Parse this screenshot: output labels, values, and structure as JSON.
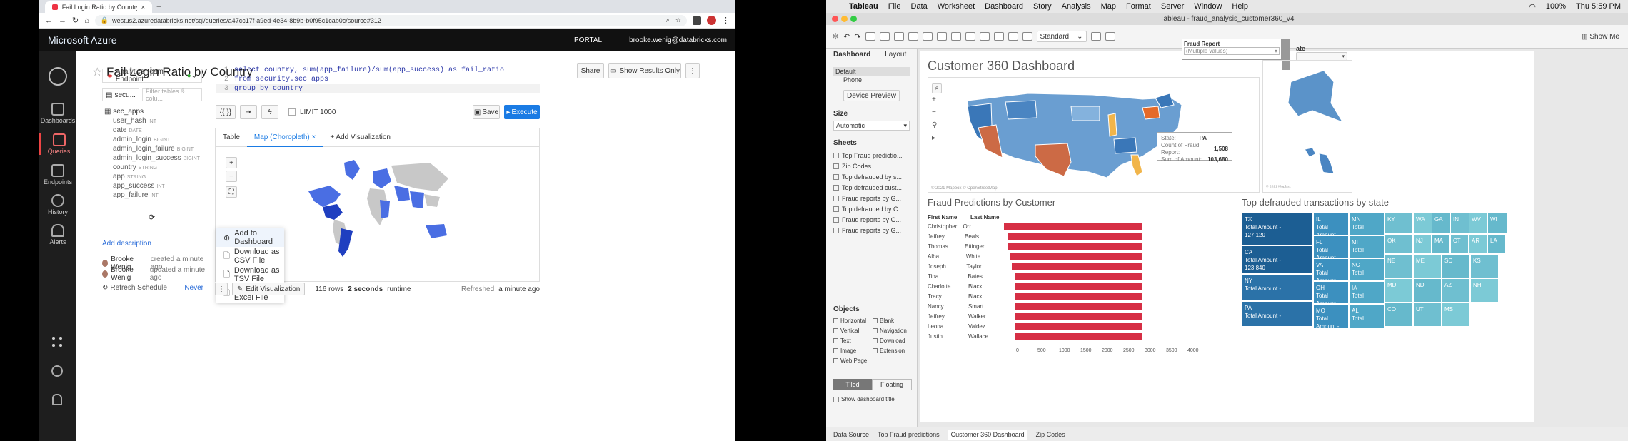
{
  "browser": {
    "tab_title": "Fail Login Ratio by Country",
    "url": "westus2.azuredatabricks.net/sql/queries/a47cc17f-a9ed-4e34-8b9b-b0f95c1cab0c/source#312"
  },
  "azure": {
    "brand": "Microsoft Azure",
    "portal": "PORTAL",
    "user": "brooke.wenig@databricks.com"
  },
  "rail": [
    {
      "label": "Dashboards"
    },
    {
      "label": "Queries"
    },
    {
      "label": "Endpoints"
    },
    {
      "label": "History"
    },
    {
      "label": "Alerts"
    }
  ],
  "query": {
    "title": "Fail Login Ratio by Country",
    "share": "Share",
    "show_results": "Show Results Only",
    "endpoint": "Analytics Team Endpoint",
    "schema_sel": "secu...",
    "filter_placeholder": "Filter tables & colu...",
    "add_description": "Add description"
  },
  "schema": {
    "table": "sec_apps",
    "columns": [
      {
        "name": "user_hash",
        "type": "INT"
      },
      {
        "name": "date",
        "type": "DATE"
      },
      {
        "name": "admin_login",
        "type": "BIGINT"
      },
      {
        "name": "admin_login_failure",
        "type": "BIGINT"
      },
      {
        "name": "admin_login_success",
        "type": "BIGINT"
      },
      {
        "name": "country",
        "type": "STRING"
      },
      {
        "name": "app",
        "type": "STRING"
      },
      {
        "name": "app_success",
        "type": "INT"
      },
      {
        "name": "app_failure",
        "type": "INT"
      }
    ]
  },
  "editor": {
    "lines": [
      {
        "n": "1",
        "code": "select country, sum(app_failure)/sum(app_success) as fail_ratio"
      },
      {
        "n": "2",
        "code": "from security.sec_apps"
      },
      {
        "n": "3",
        "code": "group by country"
      }
    ],
    "limit": "LIMIT 1000",
    "save": "Save",
    "execute": "Execute"
  },
  "results": {
    "tabs": [
      "Table",
      "Map (Choropleth)"
    ],
    "add_vis": "+ Add Visualization",
    "menu": [
      "Add to Dashboard",
      "Download as CSV File",
      "Download as TSV File",
      "Download as Excel File"
    ],
    "edit_vis": "Edit Visualization",
    "rows": "116 rows",
    "runtime": "2 seconds",
    "runtime_suffix": "runtime",
    "refreshed": "Refreshed",
    "refreshed_when": "a minute ago"
  },
  "activity": [
    {
      "user": "Brooke Wenig",
      "action": "created a minute ago"
    },
    {
      "user": "Brooke Wenig",
      "action": "updated a minute ago"
    }
  ],
  "refresh": {
    "label": "Refresh Schedule",
    "value": "Never"
  },
  "mac": {
    "app": "Tableau",
    "menus": [
      "File",
      "Data",
      "Worksheet",
      "Dashboard",
      "Story",
      "Analysis",
      "Map",
      "Format",
      "Server",
      "Window",
      "Help"
    ],
    "status": "100%",
    "clock": "Thu 5:59 PM"
  },
  "tableau": {
    "window_title": "Tableau - fraud_analysis_customer360_v4",
    "size_sel": "Standard",
    "show_me": "Show Me",
    "dash_tab": "Dashboard",
    "layout_tab": "Layout",
    "device_default": "Default",
    "device_phone": "Phone",
    "device_preview": "Device Preview",
    "size_label": "Size",
    "size_val": "Automatic",
    "sheets_label": "Sheets",
    "objects_label": "Objects",
    "tiled": "Tiled",
    "floating": "Floating",
    "show_title": "Show dashboard title"
  },
  "sheets": [
    "Top Fraud predictio...",
    "Zip Codes",
    "Top defrauded by s...",
    "Top defrauded cust...",
    "Fraud reports by G...",
    "Top defrauded by C...",
    "Fraud reports by G...",
    "Fraud reports by G..."
  ],
  "objects": [
    "Horizontal",
    "Blank",
    "Vertical",
    "Navigation",
    "Text",
    "Download",
    "Image",
    "Extension",
    "Web Page"
  ],
  "dashboard": {
    "title": "Customer 360 Dashboard",
    "fraud_report": "Fraud Report",
    "fraud_report_val": "(Multiple values)",
    "ate_label": "ate",
    "map_credit": "© 2021 Mapbox © OpenStreetMap",
    "map_credit2": "© 2021 Mapbox",
    "tooltip": {
      "state_label": "State:",
      "state": "PA",
      "count_label": "Count of Fraud Report:",
      "count": "1,508",
      "sum_label": "Sum of Amount:",
      "sum": "103,680"
    }
  },
  "fraud_chart": {
    "title": "Fraud Predictions by Customer",
    "col_first": "First Name",
    "col_last": "Last Name",
    "bar_color": "#d62f45",
    "rows": [
      [
        "Christopher",
        "Orr",
        3900
      ],
      [
        "Jeffrey",
        "Beals",
        3600
      ],
      [
        "Thomas",
        "Ettinger",
        3600
      ],
      [
        "Alba",
        "White",
        3420
      ],
      [
        "Joseph",
        "Taylor",
        3350
      ],
      [
        "Tina",
        "Bates",
        3150
      ],
      [
        "Charlotte",
        "Black",
        3100
      ],
      [
        "Tracy",
        "Black",
        3100
      ],
      [
        "Nancy",
        "Smart",
        3100
      ],
      [
        "Jeffrey",
        "Walker",
        3100
      ],
      [
        "Leona",
        "Valdez",
        3100
      ],
      [
        "Justin",
        "Wallace",
        3100
      ]
    ],
    "ticks": [
      "0",
      "500",
      "1000",
      "1500",
      "2000",
      "2500",
      "3000",
      "3500",
      "4000"
    ]
  },
  "treemap": {
    "title": "Top defrauded transactions by state",
    "big": [
      {
        "st": "TX",
        "amt": "127,120"
      },
      {
        "st": "CA",
        "amt": "123,840"
      },
      {
        "st": "NY",
        "amt": ""
      },
      {
        "st": "PA",
        "amt": ""
      }
    ],
    "label": "Total Amount -",
    "total": "Total",
    "mid": [
      "IL",
      "FL",
      "VA",
      "OH",
      "MO",
      "MN",
      "MI",
      "NC",
      "IA",
      "AL"
    ],
    "small": [
      "KY",
      "WA",
      "GA",
      "IN",
      "WV",
      "WI",
      "OK",
      "NJ",
      "MA",
      "CT",
      "AR",
      "LA",
      "NE",
      "ME",
      "SC",
      "KS",
      "MD",
      "ND",
      "AZ",
      "NH",
      "CO",
      "UT",
      "MS"
    ]
  },
  "bottom_tabs": [
    "Data Source",
    "Top Fraud predictions",
    "Customer 360 Dashboard",
    "Zip Codes"
  ]
}
